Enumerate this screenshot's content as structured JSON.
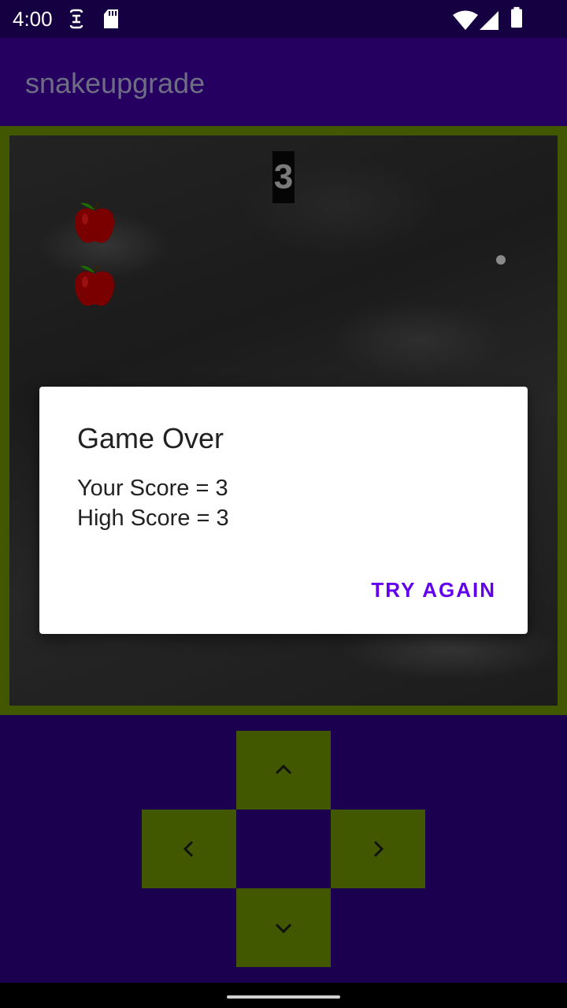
{
  "status_bar": {
    "time": "4:00",
    "left_icons": [
      "text-recognition-icon",
      "sd-card-icon"
    ],
    "right_icons": [
      "wifi-icon",
      "cellular-signal-icon",
      "battery-icon"
    ]
  },
  "app_bar": {
    "title": "snakeupgrade"
  },
  "game": {
    "score": "3",
    "apples": [
      "apple-icon",
      "apple-icon"
    ]
  },
  "dialog": {
    "title": "Game Over",
    "your_score": "Your Score = 3",
    "high_score": "High Score = 3",
    "button_label": "TRY AGAIN"
  },
  "dpad": {
    "up_icon": "chevron-up-icon",
    "left_icon": "chevron-left-icon",
    "right_icon": "chevron-right-icon",
    "down_icon": "chevron-down-icon"
  },
  "colors": {
    "status_bar": "#150042",
    "app_bar": "#260061",
    "background": "#1a004f",
    "board_border": "#425800",
    "dpad": "#425800",
    "accent": "#6200ee",
    "apple": "#7a0000"
  }
}
